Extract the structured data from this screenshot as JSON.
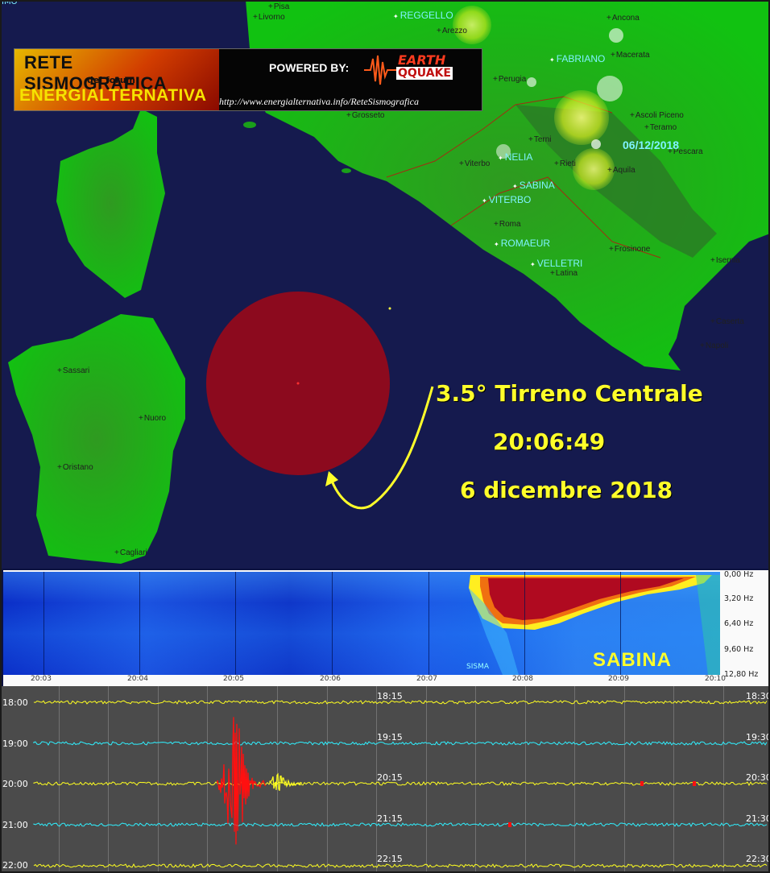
{
  "banner": {
    "title_line1": "RETE SISMOGRAFICA",
    "title_line2": "del forum",
    "title_line3": "ENERGIALTERNATIVA",
    "powered_by": "POWERED BY:",
    "logo_top": "EARTH",
    "logo_bottom": "QQUAKE",
    "url": "http://www.energialternativa.info/ReteSismografica"
  },
  "map": {
    "corner_label": "IMO",
    "date": "06/12/2018",
    "cities": [
      "Pisa",
      "Livorno",
      "Arezzo",
      "Ancona",
      "Macerata",
      "Perugia",
      "Grosseto",
      "Ascoli Piceno",
      "Teramo",
      "Terni",
      "Pescara",
      "Viterbo",
      "Rieti",
      "Aquila",
      "Roma",
      "Frosinone",
      "Latina",
      "Isernia",
      "Caserta",
      "Napoli",
      "Sassari",
      "Nuoro",
      "Oristano",
      "Cagliari"
    ],
    "stations": [
      "REGGELLO",
      "FABRIANO",
      "NELIA",
      "SABINA",
      "VITERBO",
      "ROMAEUR",
      "VELLETRI"
    ]
  },
  "event": {
    "magnitude_place": "3.5° Tirreno Centrale",
    "time": "20:06:49",
    "date": "6 dicembre 2018"
  },
  "spectrogram": {
    "station": "SABINA",
    "event_marker": "SISMA",
    "time_ticks": [
      "20:03",
      "20:04",
      "20:05",
      "20:06",
      "20:07",
      "20:08",
      "20:09",
      "20:10"
    ],
    "freq_ticks": [
      "0,00 Hz",
      "3,20 Hz",
      "6,40 Hz",
      "9,60 Hz",
      "12,80 Hz"
    ]
  },
  "helicorder": {
    "left_labels": [
      "18:00",
      "19:00",
      "20:00",
      "21:00",
      "22:00"
    ],
    "mid_labels": [
      "18:15",
      "19:15",
      "20:15",
      "21:15",
      "22:15"
    ],
    "right_labels": [
      "18:30",
      "19:30",
      "20:30",
      "21:30",
      "22:30"
    ],
    "trace_colors": [
      "#ffff20",
      "#2ff0ff",
      "#ffff20",
      "#2ff0ff",
      "#ffff20"
    ],
    "event_color": "#ff1010"
  }
}
